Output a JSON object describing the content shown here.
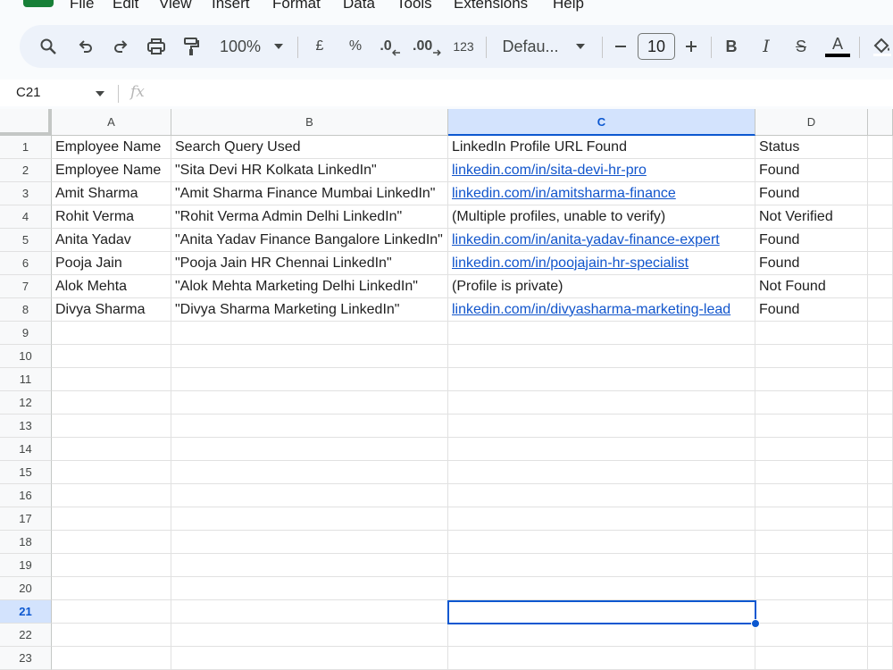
{
  "menu": {
    "items": [
      "File",
      "Edit",
      "View",
      "Insert",
      "Format",
      "Data",
      "Tools",
      "Extensions",
      "Help"
    ]
  },
  "toolbar": {
    "zoom": "100%",
    "currency": "£",
    "percent": "%",
    "decrease_decimal": ".0",
    "increase_decimal": ".00",
    "number_format": "123",
    "font": "Defau...",
    "font_size": "10",
    "bold": "B",
    "italic": "I",
    "strike": "S",
    "text_color": "A"
  },
  "formula_bar": {
    "name_box": "C21",
    "fx": "fx",
    "value": ""
  },
  "grid": {
    "columns": [
      "A",
      "B",
      "C",
      "D"
    ],
    "selected_column": "C",
    "selected_row": 21,
    "row_numbers": [
      "1",
      "2",
      "3",
      "4",
      "5",
      "6",
      "7",
      "8",
      "9",
      "10",
      "11",
      "12",
      "13",
      "14",
      "15",
      "16",
      "17",
      "18",
      "19",
      "20",
      "21",
      "22",
      "23"
    ],
    "rows": [
      [
        "Employee Name",
        "Search Query Used",
        "LinkedIn Profile URL Found",
        "Status"
      ],
      [
        "Employee Name",
        "\"Sita Devi HR Kolkata LinkedIn\"",
        "linkedin.com/in/sita-devi-hr-pro",
        "Found"
      ],
      [
        "Amit Sharma",
        "\"Amit Sharma Finance Mumbai LinkedIn\"",
        "linkedin.com/in/amitsharma-finance",
        "Found"
      ],
      [
        "Rohit Verma",
        "\"Rohit Verma Admin Delhi LinkedIn\"",
        "(Multiple profiles, unable to verify)",
        "Not Verified"
      ],
      [
        "Anita Yadav",
        "\"Anita Yadav Finance Bangalore LinkedIn\"",
        "linkedin.com/in/anita-yadav-finance-expert",
        "Found"
      ],
      [
        "Pooja Jain",
        "\"Pooja Jain HR Chennai LinkedIn\"",
        "linkedin.com/in/poojajain-hr-specialist",
        "Found"
      ],
      [
        "Alok Mehta",
        "\"Alok Mehta Marketing Delhi LinkedIn\"",
        "(Profile is private)",
        "Not Found"
      ],
      [
        "Divya Sharma",
        "\"Divya Sharma Marketing LinkedIn\"",
        "linkedin.com/in/divyasharma-marketing-lead",
        "Found"
      ]
    ],
    "link_color": "#1155cc",
    "selection_color": "#0b57d0"
  }
}
